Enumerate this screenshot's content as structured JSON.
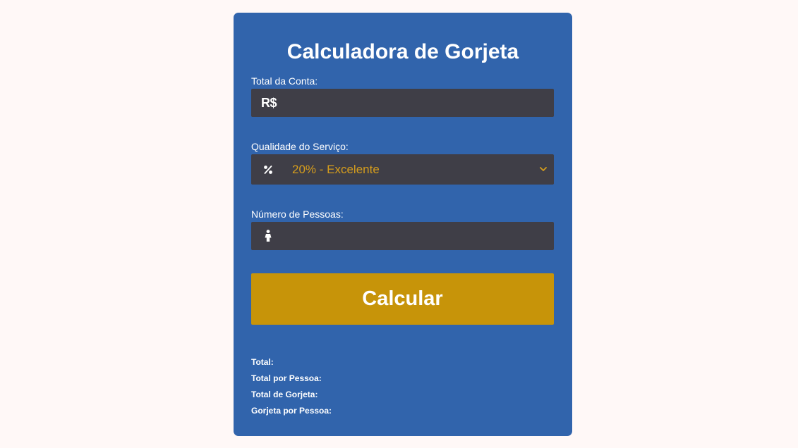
{
  "page": {
    "background": "#fff8f7"
  },
  "card": {
    "background": "#3164ac",
    "title": "Calculadora de Gorjeta"
  },
  "bill": {
    "label": "Total da Conta:",
    "icon": "R$",
    "value": "",
    "placeholder": ""
  },
  "service": {
    "label": "Qualidade do Serviço:",
    "icon": "percent-icon",
    "selected": "20% - Excelente",
    "accent": "#d59d1d"
  },
  "people": {
    "label": "Número de Pessoas:",
    "icon": "person-icon",
    "value": "",
    "placeholder": ""
  },
  "button": {
    "label": "Calcular",
    "color": "#c79409"
  },
  "results": {
    "total": "Total:",
    "total_per_person": "Total por Pessoa:",
    "tip_total": "Total de Gorjeta:",
    "tip_per_person": "Gorjeta por Pessoa:"
  }
}
